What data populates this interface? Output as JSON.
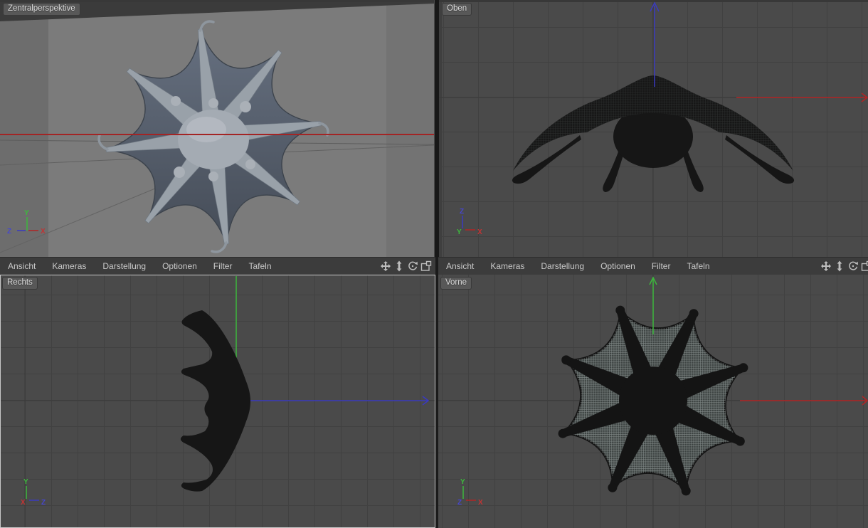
{
  "menu": {
    "items": [
      "Ansicht",
      "Kameras",
      "Darstellung",
      "Optionen",
      "Filter",
      "Tafeln"
    ]
  },
  "toolbar": {
    "icons": [
      {
        "name": "pan-view-icon"
      },
      {
        "name": "dolly-zoom-icon"
      },
      {
        "name": "rotate-view-icon"
      },
      {
        "name": "toggle-viewport-icon"
      }
    ]
  },
  "viewports": {
    "perspective": {
      "label": "Zentralperspektive",
      "gizmo": {
        "up": "Y",
        "left": "Z",
        "right": "X"
      }
    },
    "top": {
      "label": "Oben",
      "gizmo": {
        "up": "Z",
        "origin": "Y",
        "right": "X"
      }
    },
    "right": {
      "label": "Rechts",
      "gizmo": {
        "up": "Y",
        "origin": "X",
        "right": "Z"
      }
    },
    "front": {
      "label": "Vorne",
      "gizmo": {
        "up": "Y",
        "origin": "Z",
        "right": "X"
      }
    }
  },
  "colors": {
    "axis_x_red": "#b22424",
    "axis_y_green": "#3db83d",
    "axis_z_blue": "#3a3ac0",
    "viewport_dark_bg": "#4a4a4a",
    "viewport_grid": "#414141",
    "menubar_bg": "#3c3c3c",
    "perspective_bg": "#7b7b7b",
    "model_silhouette": "#161616",
    "active_view_border": "#c9c9c9"
  }
}
